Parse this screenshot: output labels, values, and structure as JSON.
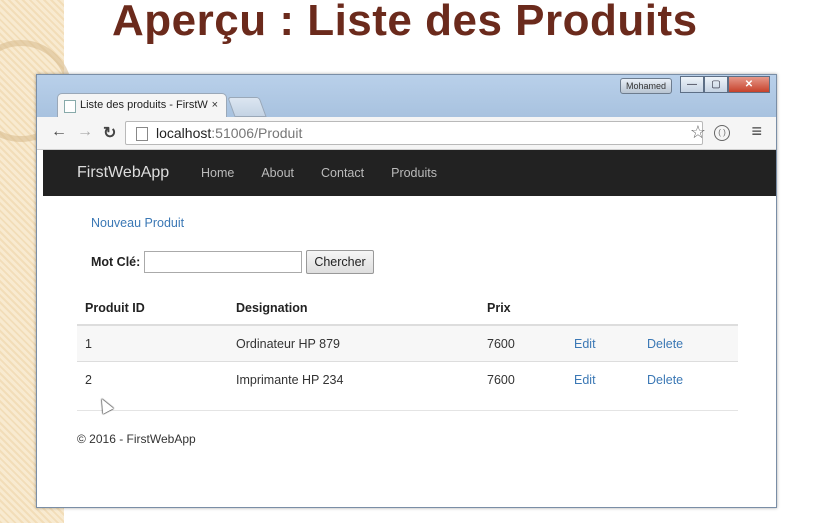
{
  "slide": {
    "title": "Aperçu : Liste des Produits"
  },
  "window": {
    "user_badge": "Mohamed",
    "controls": {
      "minimize": "—",
      "maximize": "▢",
      "close": "✕"
    }
  },
  "browser": {
    "tab_title": "Liste des produits - FirstW",
    "tab_close": "×",
    "url_host": "localhost",
    "url_path": ":51006/Produit"
  },
  "icons": {
    "back": "back-arrow-icon",
    "forward": "forward-arrow-icon",
    "reload": "reload-icon",
    "star": "star-icon",
    "menu": "hamburger-menu-icon"
  },
  "navbar": {
    "brand": "FirstWebApp",
    "links": [
      "Home",
      "About",
      "Contact",
      "Produits"
    ]
  },
  "page": {
    "new_product_link": "Nouveau Produit",
    "search": {
      "label": "Mot Clé:",
      "value": "",
      "button": "Chercher"
    },
    "table": {
      "headers": [
        "Produit ID",
        "Designation",
        "Prix",
        "",
        ""
      ],
      "rows": [
        {
          "id": "1",
          "designation": "Ordinateur HP 879",
          "prix": "7600",
          "edit": "Edit",
          "delete": "Delete"
        },
        {
          "id": "2",
          "designation": "Imprimante HP 234",
          "prix": "7600",
          "edit": "Edit",
          "delete": "Delete"
        }
      ]
    },
    "footer": "© 2016 - FirstWebApp"
  },
  "colors": {
    "title": "#6b2a1c",
    "navbar": "#222222",
    "link": "#3b78b5"
  }
}
